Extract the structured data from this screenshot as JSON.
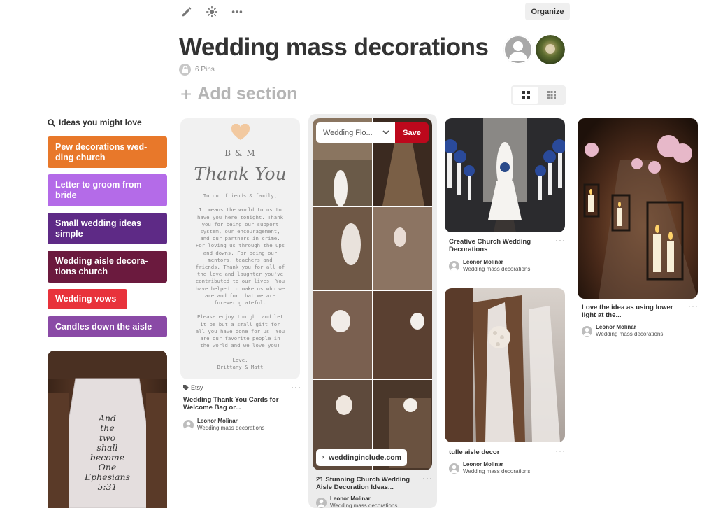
{
  "toolbar": {
    "edit_icon": "pencil-icon",
    "sparkle_icon": "sparkle-icon",
    "more_icon": "more-icon",
    "organize_label": "Organize"
  },
  "board": {
    "title": "Wedding mass decorations",
    "pin_count": "6 Pins",
    "add_section_label": "Add section"
  },
  "ideas": {
    "title": "Ideas you might love",
    "items": [
      {
        "label": "Pew decorations wed-\nding church",
        "color": "#e8782a"
      },
      {
        "label": "Letter to groom from bride",
        "color": "#b46be8"
      },
      {
        "label": "Small wedding ideas simple",
        "color": "#5e2a86"
      },
      {
        "label": "Wedding aisle decora-\ntions church",
        "color": "#6b1a3e"
      },
      {
        "label": "Wedding vows",
        "color": "#e8323b"
      },
      {
        "label": "Candles down the aisle",
        "color": "#8a4aa6"
      }
    ]
  },
  "pins": {
    "thanks": {
      "initials": "B & M",
      "script": "Thank You",
      "body": "To our friends & family,\n\nIt means the world to us to\nhave you here tonight. Thank\nyou for being our support\nsystem, our encouragement,\nand our partners in crime.\nFor loving us through the ups\nand downs. For being our\nmentors, teachers and\nfriends. Thank you for all of\nthe love and laughter you've\ncontributed to our lives. You\nhave helped to make us who we\nare and for that we are\nforever grateful.\n\nPlease enjoy tonight and let\nit be but a small gift for\nall you have done for us. You\nare our favorite people in\nthe world and we love you!\n\nLove,\nBrittany & Matt",
      "source": "Etsy",
      "title": "Wedding Thank You Cards for Welcome Bag or...",
      "author": "Leonor Molinar",
      "board": "Wedding mass decorations"
    },
    "collage": {
      "board_select": "Wedding Flo...",
      "save_label": "Save",
      "link": "weddinginclude.com",
      "title": "21 Stunning Church Wedding Aisle Decoration Ideas...",
      "author": "Leonor Molinar",
      "board": "Wedding mass decorations"
    },
    "creative": {
      "title": "Creative Church Wedding Decorations",
      "author": "Leonor Molinar",
      "board": "Wedding mass decorations"
    },
    "tulle": {
      "title": "tulle aisle decor",
      "author": "Leonor Molinar",
      "board": "Wedding mass decorations"
    },
    "candles": {
      "title": "Love the idea as using lower light at the...",
      "author": "Leonor Molinar",
      "board": "Wedding mass decorations"
    },
    "runner": {
      "text": "And\nthe\ntwo\nshall\nbecome\nOne\nEphesians\n5:31"
    }
  },
  "colors": {
    "save_red": "#bd081c",
    "text_dark": "#333333",
    "muted": "#8e8e8e"
  }
}
